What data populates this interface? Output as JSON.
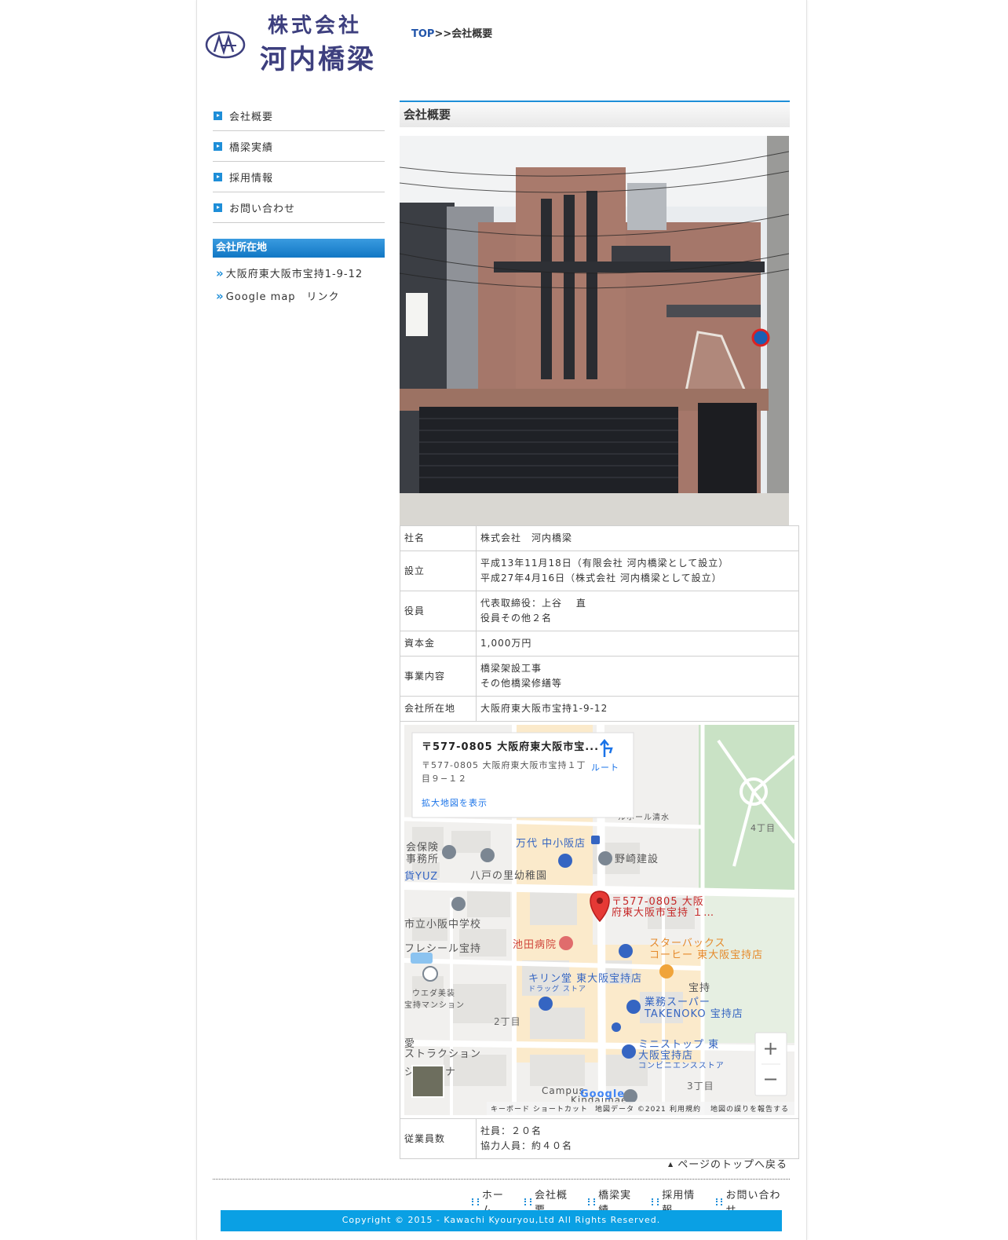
{
  "header": {
    "logo_line1": "株式会社",
    "logo_line2": "河内橋梁",
    "breadcrumb": {
      "top": "TOP",
      "sep": ">>",
      "current": "会社概要"
    }
  },
  "sidebar": {
    "nav": [
      {
        "label": "会社概要"
      },
      {
        "label": "橋梁実績"
      },
      {
        "label": "採用情報"
      },
      {
        "label": "お問い合わせ"
      }
    ],
    "location_title": "会社所在地",
    "location_items": [
      {
        "label": "大阪府東大阪市宝持1-9-12"
      },
      {
        "label": "Google map　リンク"
      }
    ]
  },
  "main": {
    "title": "会社概要",
    "rows": [
      {
        "key": "社名",
        "v1": "株式会社　河内橋梁",
        "v2": ""
      },
      {
        "key": "設立",
        "v1": "平成13年11月18日（有限会社 河内橋梁として設立）",
        "v2": "平成27年4月16日（株式会社 河内橋梁として設立）"
      },
      {
        "key": "役員",
        "v1": "代表取締役：上谷　 直",
        "v2": "役員その他２名"
      },
      {
        "key": "資本金",
        "v1": "1,000万円",
        "v2": ""
      },
      {
        "key": "事業内容",
        "v1": "橋梁架設工事",
        "v2": "その他橋梁修繕等"
      },
      {
        "key": "会社所在地",
        "v1": "大阪府東大阪市宝持1-9-12",
        "v2": ""
      },
      {
        "key": "従業員数",
        "v1": "社員：２０名",
        "v2": "協力人員：約４０名"
      }
    ]
  },
  "map": {
    "card_title": "〒577-0805 大阪府東大阪市宝...",
    "card_addr1": "〒577-0805 大阪府東大阪市宝持１丁",
    "card_addr2": "目９−１２",
    "route": "ルート",
    "enlarge": "拡大地図を表示",
    "marker_label1": "〒577-0805 大阪",
    "marker_label2": "府東大阪市宝持 １…",
    "labels": {
      "hall": "ルホール清水",
      "chome4": "4丁目",
      "hoken1": "会保険",
      "hoken2": "事務所",
      "mandai": "万代 中小阪店",
      "nozaki": "野崎建設",
      "yuz": "貨YUZ",
      "yatono": "八戸の里幼稚園",
      "school": "市立小阪中学校",
      "fresil": "フレシール宝持",
      "ikeda": "池田病院",
      "starbucks1": "スターバックス",
      "starbucks2": "コーヒー 東大阪宝持店",
      "kirindo": "キリン堂 東大阪宝持店",
      "drug": "ドラッグ ストア",
      "houji": "宝持",
      "ueda1": "ウエダ美装",
      "ueda2": "宝持マンション",
      "gyomu1": "業務スーパー",
      "gyomu2": "TAKENOKO 宝持店",
      "chome2": "2丁目",
      "ai": "愛",
      "traction": "ストラクション",
      "ministop1": "ミニストップ 東",
      "ministop2": "大阪宝持店",
      "konbini": "コンビニエンスストア",
      "ji": "ジ",
      "na": "ナ",
      "campus": "Campus",
      "kindaimae": "Kindaimae",
      "chome3": "3丁目",
      "google": "Google"
    },
    "attrib": {
      "keyboard": "キーボード ショートカット",
      "data": "地図データ ©2021",
      "terms": "利用規約",
      "report": "地図の誤りを報告する"
    },
    "zoom_in": "+",
    "zoom_out": "−"
  },
  "footer": {
    "page_top": "ページのトップへ戻る",
    "nav": [
      {
        "label": "ホーム"
      },
      {
        "label": "会社概要"
      },
      {
        "label": "橋梁実績"
      },
      {
        "label": "採用情報"
      },
      {
        "label": "お問い合わせ"
      }
    ],
    "copyright": "Copyright © 2015 - Kawachi Kyouryou,Ltd All Rights Reserved."
  },
  "colors": {
    "accent": "#1e8ed8",
    "logo": "#3d3f7e",
    "copyright_bg": "#0aa0e4"
  }
}
